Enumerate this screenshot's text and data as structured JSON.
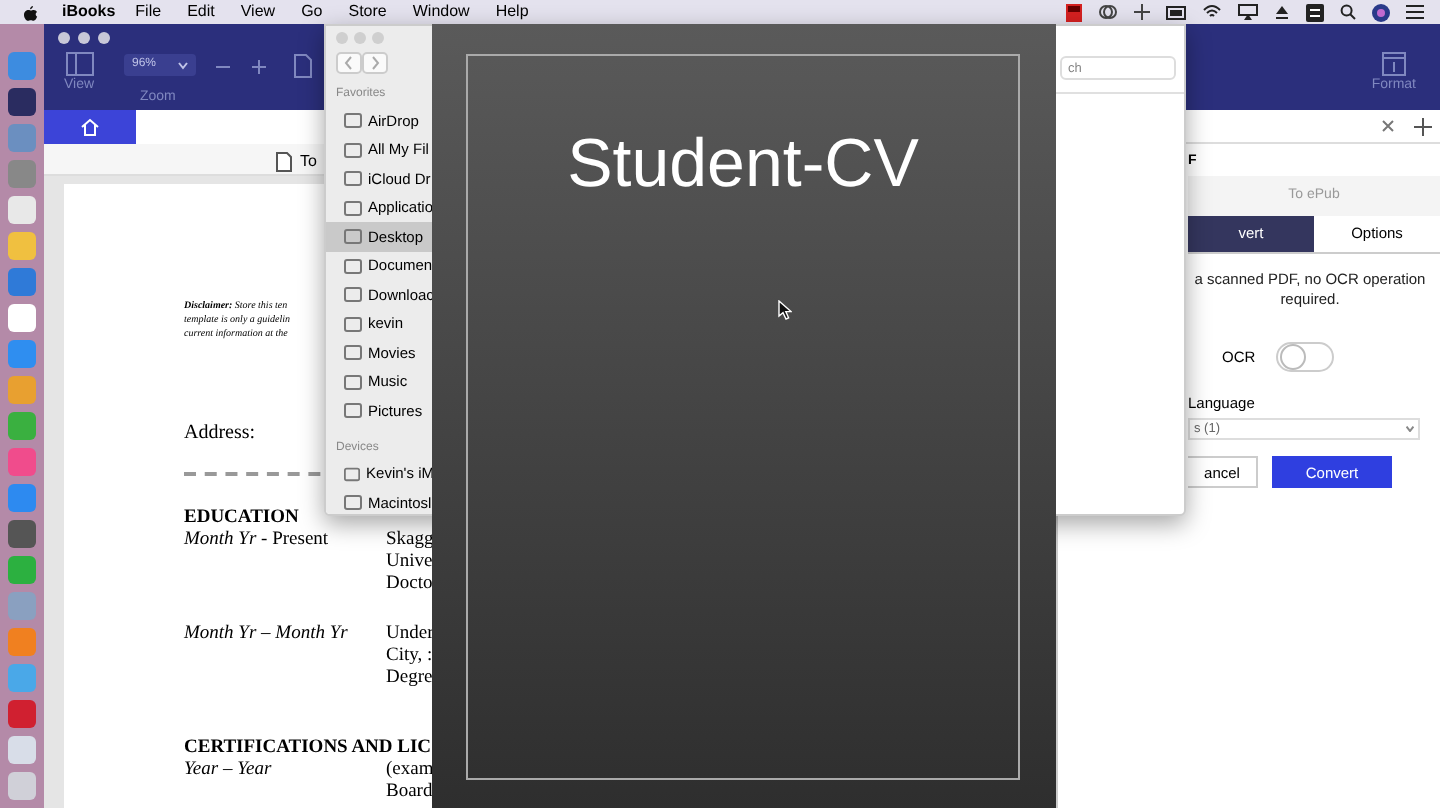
{
  "menu_bar": {
    "app": "iBooks",
    "menus": [
      "File",
      "Edit",
      "View",
      "Go",
      "Store",
      "Window",
      "Help"
    ]
  },
  "app_window": {
    "toolbar": {
      "view_label": "View",
      "zoom_value": "96%",
      "zoom_label": "Zoom",
      "format_label": "Format"
    },
    "document_tab": {
      "label": "To"
    },
    "document": {
      "disclaimer": [
        "**Disclaimer:** Store this ten",
        "template is only a guidelin",
        "current information at the"
      ],
      "address_label": "Address:",
      "sections": [
        {
          "heading": "EDUCATION",
          "entries": [
            {
              "date": "*Month Yr* - Present",
              "lines": [
                "Skagg",
                "Unive",
                "Docto"
              ]
            },
            {
              "date": "*Month Yr – Month Yr*",
              "lines": [
                "Under",
                "City, :",
                "Degre"
              ]
            }
          ]
        },
        {
          "heading": "CERTIFICATIONS AND LIC",
          "entries": [
            {
              "date": "*Year – Year*",
              "lines": [
                "(exam",
                "Board"
              ]
            }
          ]
        }
      ]
    }
  },
  "finder": {
    "search_placeholder": "ch",
    "sections": [
      {
        "title": "Favorites",
        "items": [
          {
            "label": "AirDrop",
            "selected": false
          },
          {
            "label": "All My Fil",
            "selected": false
          },
          {
            "label": "iCloud Dr",
            "selected": false
          },
          {
            "label": "Applicatio",
            "selected": false
          },
          {
            "label": "Desktop",
            "selected": true
          },
          {
            "label": "Documen",
            "selected": false
          },
          {
            "label": "Downloac",
            "selected": false
          },
          {
            "label": "kevin",
            "selected": false
          },
          {
            "label": "Movies",
            "selected": false
          },
          {
            "label": "Music",
            "selected": false
          },
          {
            "label": "Pictures",
            "selected": false
          }
        ]
      },
      {
        "title": "Devices",
        "items": [
          {
            "label": "Kevin's iM",
            "selected": false
          },
          {
            "label": "Macintosl",
            "selected": false
          }
        ]
      }
    ]
  },
  "preview": {
    "title": "Student-CV"
  },
  "convert_panel": {
    "heading": "F",
    "subtitle": "To ePub",
    "tabs": [
      {
        "label": "vert",
        "selected": true
      },
      {
        "label": "Options",
        "selected": false
      }
    ],
    "message": "a scanned PDF, no OCR operation required.",
    "ocr": {
      "label": "OCR",
      "on": false
    },
    "language": {
      "label": "Language",
      "value": "s (1)"
    },
    "buttons": [
      {
        "label": "ancel",
        "kind": "secondary"
      },
      {
        "label": "Convert",
        "kind": "primary"
      }
    ]
  }
}
